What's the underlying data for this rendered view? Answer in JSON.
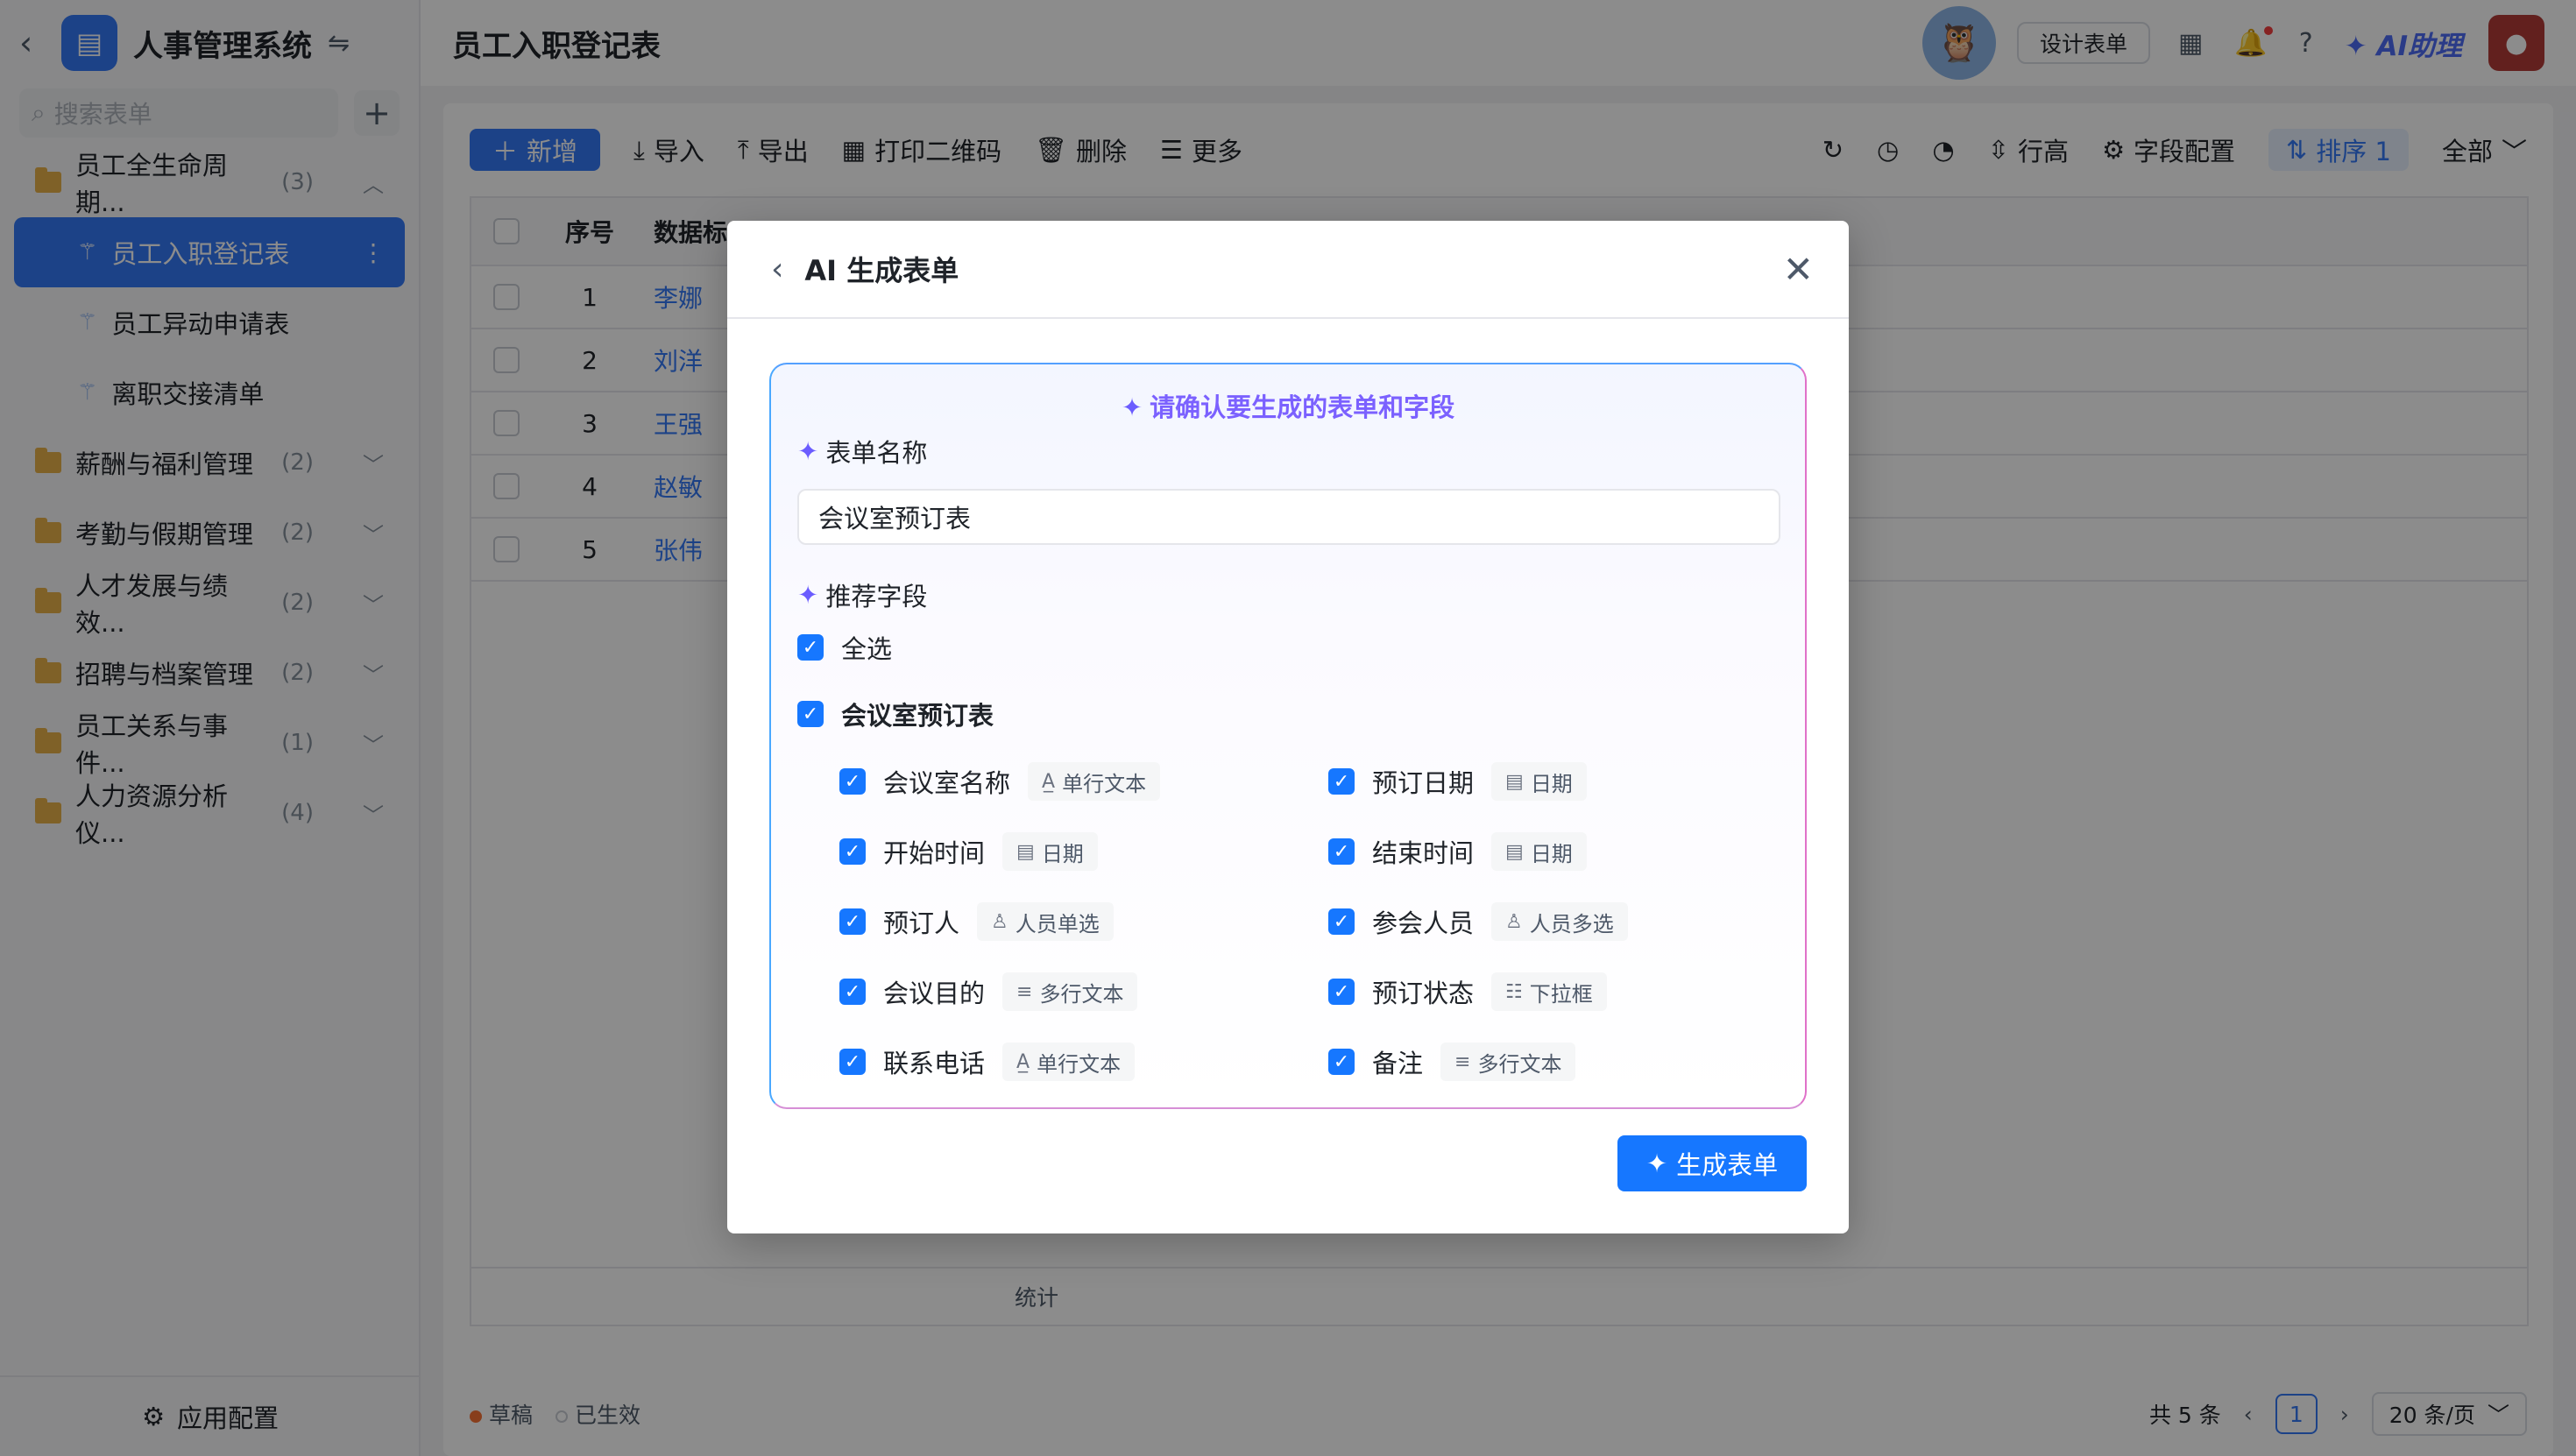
{
  "app": {
    "title": "人事管理系统",
    "search_placeholder": "搜索表单",
    "footer_label": "应用配置"
  },
  "sidebar": {
    "groups": [
      {
        "label": "员工全生命周期...",
        "count": "(3)"
      },
      {
        "label": "薪酬与福利管理",
        "count": "(2)"
      },
      {
        "label": "考勤与假期管理",
        "count": "(2)"
      },
      {
        "label": "人才发展与绩效...",
        "count": "(2)"
      },
      {
        "label": "招聘与档案管理",
        "count": "(2)"
      },
      {
        "label": "员工关系与事件...",
        "count": "(1)"
      },
      {
        "label": "人力资源分析仪...",
        "count": "(4)"
      }
    ],
    "sub_items": [
      {
        "label": "员工入职登记表"
      },
      {
        "label": "员工异动申请表"
      },
      {
        "label": "离职交接清单"
      }
    ]
  },
  "topbar": {
    "page_title": "员工入职登记表",
    "design_button": "设计表单",
    "ai_assistant": "AI助理"
  },
  "toolbar": {
    "new": "新增",
    "import": "导入",
    "export": "导出",
    "print_qr": "打印二维码",
    "delete": "删除",
    "more": "更多",
    "row_height": "行高",
    "field_config": "字段配置",
    "sort": "排序 1",
    "filter_all": "全部"
  },
  "table": {
    "headers": {
      "index": "序号",
      "title": "数据标"
    },
    "rows": [
      {
        "index": "1",
        "name": "李娜"
      },
      {
        "index": "2",
        "name": "刘洋"
      },
      {
        "index": "3",
        "name": "王强"
      },
      {
        "index": "4",
        "name": "赵敏"
      },
      {
        "index": "5",
        "name": "张伟"
      }
    ],
    "footer_stat": "统计"
  },
  "status_bar": {
    "draft": "草稿",
    "active": "已生效",
    "total": "共 5 条",
    "page": "1",
    "page_size": "20 条/页"
  },
  "modal": {
    "title": "AI 生成表单",
    "confirm_title": "请确认要生成的表单和字段",
    "form_name_label": "表单名称",
    "form_name_value": "会议室预订表",
    "recommended_label": "推荐字段",
    "select_all": "全选",
    "form_group": "会议室预订表",
    "fields": [
      {
        "name": "会议室名称",
        "type": "单行文本",
        "icon": "text-type-icon"
      },
      {
        "name": "预订日期",
        "type": "日期",
        "icon": "calendar-icon"
      },
      {
        "name": "开始时间",
        "type": "日期",
        "icon": "calendar-icon"
      },
      {
        "name": "结束时间",
        "type": "日期",
        "icon": "calendar-icon"
      },
      {
        "name": "预订人",
        "type": "人员单选",
        "icon": "person-icon"
      },
      {
        "name": "参会人员",
        "type": "人员多选",
        "icon": "people-icon"
      },
      {
        "name": "会议目的",
        "type": "多行文本",
        "icon": "multiline-icon"
      },
      {
        "name": "预订状态",
        "type": "下拉框",
        "icon": "dropdown-icon"
      },
      {
        "name": "联系电话",
        "type": "单行文本",
        "icon": "text-type-icon"
      },
      {
        "name": "备注",
        "type": "多行文本",
        "icon": "multiline-icon"
      }
    ],
    "generate_button": "生成表单"
  },
  "colors": {
    "primary": "#1677ff",
    "accent_purple": "#7b61ff",
    "draft_dot": "#f77234"
  }
}
